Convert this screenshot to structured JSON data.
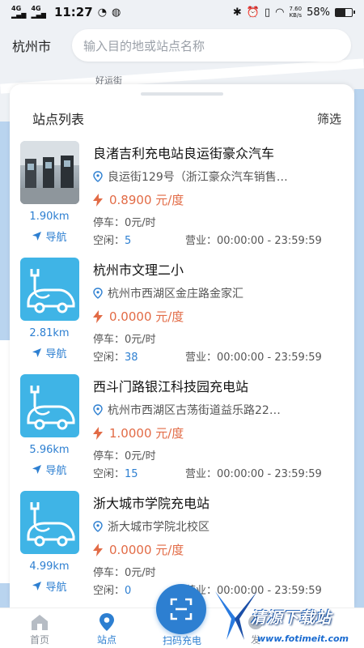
{
  "status_bar": {
    "signal_1": "4G",
    "signal_2": "4G",
    "time": "11:27",
    "net_speed_value": "7.60",
    "net_speed_unit": "KB/s",
    "battery": "58%",
    "battery_level": 0.58
  },
  "search": {
    "city": "杭州市",
    "placeholder": "输入目的地或站点名称"
  },
  "map_labels": [
    "好运街"
  ],
  "panel": {
    "title": "站点列表",
    "filter_label": "筛选"
  },
  "stations": [
    {
      "name": "良渚吉利充电站良运街豪众汽车",
      "address": "良运街129号（浙江豪众汽车销售…",
      "price": "0.8900 元/度",
      "distance": "1.90km",
      "nav_label": "导航",
      "parking_label": "停车：",
      "parking_value": "0元/时",
      "free_label": "空闲：",
      "free_value": "5",
      "hours_label": "营业：",
      "hours_value": "00:00:00 - 23:59:59",
      "thumb": "photo"
    },
    {
      "name": "杭州市文理二小",
      "address": "杭州市西湖区金庄路金家汇",
      "price": "0.0000 元/度",
      "distance": "2.81km",
      "nav_label": "导航",
      "parking_label": "停车：",
      "parking_value": "0元/时",
      "free_label": "空闲：",
      "free_value": "38",
      "hours_label": "营业：",
      "hours_value": "00:00:00 - 23:59:59",
      "thumb": "ev-icon"
    },
    {
      "name": "西斗门路银江科技园充电站",
      "address": "杭州市西湖区古荡街道益乐路22…",
      "price": "1.0000 元/度",
      "distance": "5.96km",
      "nav_label": "导航",
      "parking_label": "停车：",
      "parking_value": "0元/时",
      "free_label": "空闲：",
      "free_value": "15",
      "hours_label": "营业：",
      "hours_value": "00:00:00 - 23:59:59",
      "thumb": "ev-icon"
    },
    {
      "name": "浙大城市学院充电站",
      "address": "浙大城市学院北校区",
      "price": "0.0000 元/度",
      "distance": "4.99km",
      "nav_label": "导航",
      "parking_label": "停车：",
      "parking_value": "0元/时",
      "free_label": "空闲：",
      "free_value": "0",
      "hours_label": "营业：",
      "hours_value": "00:00:00 - 23:59:59",
      "thumb": "ev-icon"
    }
  ],
  "tabbar": {
    "home": "首页",
    "station": "站点",
    "scan": "扫码充电",
    "tab4": "发"
  },
  "watermark": {
    "title": "清源下载站",
    "url": "www.fotimeit.com"
  },
  "colors": {
    "accent": "#2d7fd1",
    "price": "#e26b46",
    "thumb": "#3fb4e6"
  }
}
